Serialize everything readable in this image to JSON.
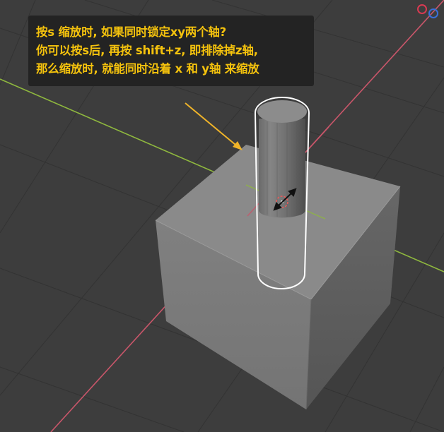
{
  "tooltip": {
    "lines": [
      "按s 缩放时, 如果同时锁定xy两个轴?",
      "你可以按s后, 再按 shift+z, 即排除掉z轴,",
      "那么缩放时, 就能同时沿着 x 和 y轴 来缩放"
    ],
    "color": "#f4c20d",
    "background": "#222222"
  },
  "colors": {
    "viewport_bg": "#3d3d3d",
    "grid": "#353535",
    "x_axis": "#c9566a",
    "y_axis": "#8fb83e",
    "cube_top": "#8a8a8a",
    "cube_left": "#7b7b7b",
    "cube_right": "#5f5f5f",
    "selection_outline": "#ffffff",
    "arrow": "#f0b429"
  },
  "icons": {
    "gizmo_x": "circle-red",
    "gizmo_y": "circle-blue",
    "cursor": "scale-cursor-icon",
    "pivot": "pivot-point-icon"
  }
}
